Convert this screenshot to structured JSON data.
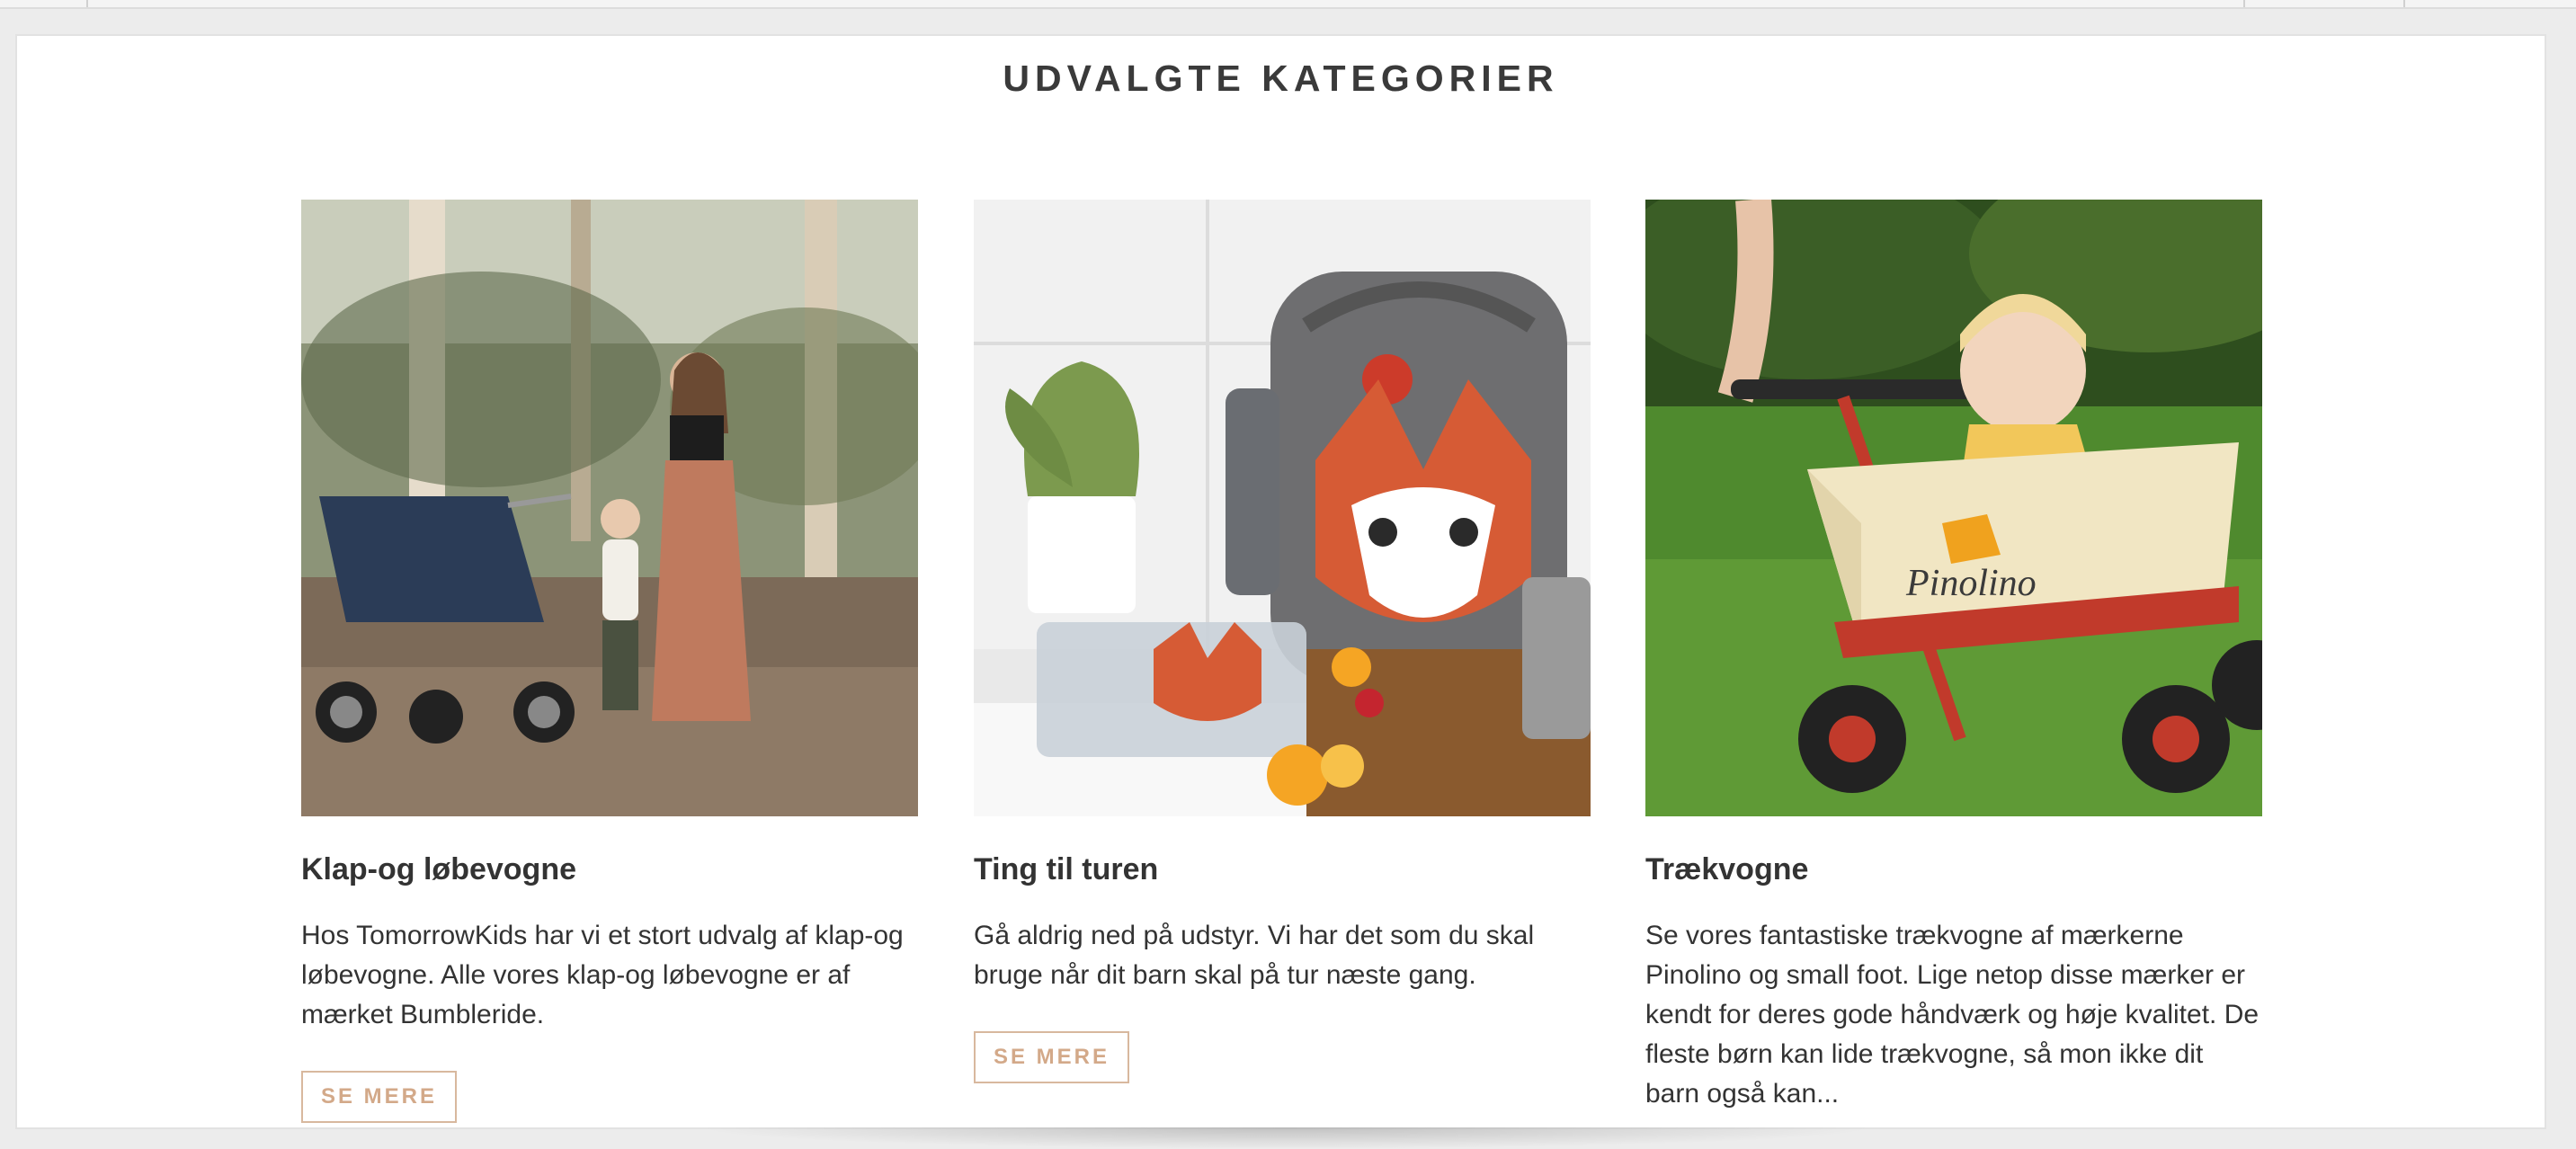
{
  "section": {
    "title": "UDVALGTE KATEGORIER"
  },
  "categories": [
    {
      "title": "Klap-og løbevogne",
      "description": "Hos TomorrowKids har vi et stort udvalg af klap-og løbevogne. Alle vores klap-og løbevogne er af mærket Bumbleride.",
      "button": "SE MERE",
      "image_icon": "stroller-photo"
    },
    {
      "title": "Ting til turen",
      "description": "Gå aldrig ned på udstyr. Vi har det som du skal bruge når dit barn skal på tur næste gang.",
      "button": "SE MERE",
      "image_icon": "fox-backpack-photo"
    },
    {
      "title": "Trækvogne",
      "description": "Se vores fantastiske trækvogne af mærkerne Pinolino og small foot. Lige netop disse mærker er kendt for deres gode håndværk og høje kvalitet. De fleste børn kan lide trækvogne, så mon ikke dit barn også kan...",
      "button": null,
      "image_icon": "wagon-photo",
      "brand_text": "Pinolino"
    }
  ],
  "colors": {
    "accent": "#d3a989",
    "text": "#333333"
  }
}
